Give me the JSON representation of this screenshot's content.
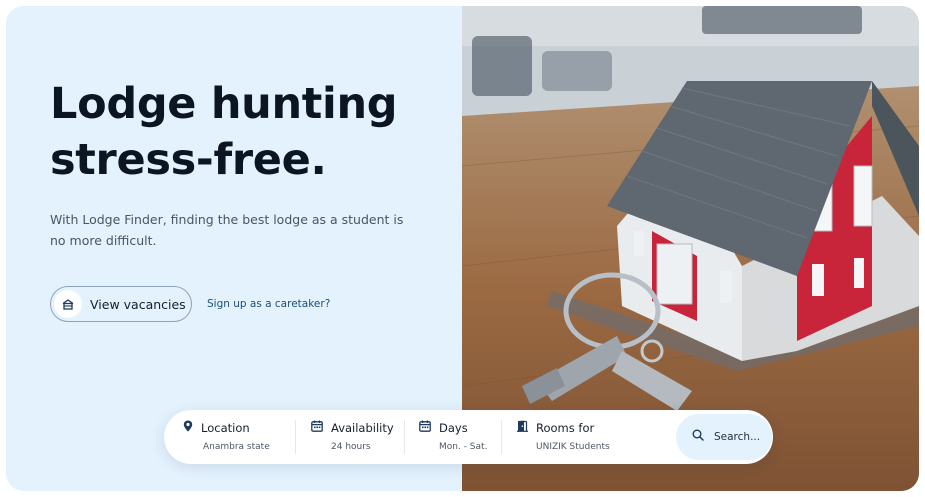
{
  "hero": {
    "headline_line1": "Lodge hunting",
    "headline_line2": "stress-free.",
    "subtext": "With Lodge Finder, finding the best lodge as a student is no more difficult.",
    "view_button_label": "View vacancies",
    "view_button_icon": "house-icon",
    "signup_link": "Sign up as a caretaker?"
  },
  "search": {
    "fields": [
      {
        "label": "Location",
        "value": "Anambra state",
        "icon": "location-pin-icon"
      },
      {
        "label": "Availability",
        "value": "24 hours",
        "icon": "calendar-icon"
      },
      {
        "label": "Days",
        "value": "Mon. - Sat.",
        "icon": "calendar-icon"
      },
      {
        "label": "Rooms for",
        "value": "UNIZIK Students",
        "icon": "door-icon"
      }
    ],
    "button_label": "Search...",
    "button_icon": "search-icon"
  },
  "colors": {
    "panel_bg": "#e3f2fd",
    "text_dark": "#0c1622",
    "link": "#1b4f7a",
    "icon": "#1e3a5c"
  }
}
